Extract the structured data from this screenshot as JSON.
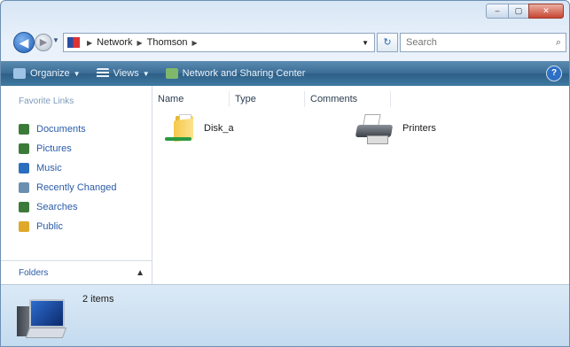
{
  "window": {
    "caption_buttons": {
      "minimize": "–",
      "maximize": "▢",
      "close": "✕"
    }
  },
  "address_bar": {
    "segments": [
      "Network",
      "Thomson"
    ],
    "search_placeholder": "Search"
  },
  "toolbar": {
    "organize_label": "Organize",
    "views_label": "Views",
    "network_center_label": "Network and Sharing Center",
    "help_label": "?"
  },
  "navigation_pane": {
    "heading": "Favorite Links",
    "links": [
      {
        "label": "Documents",
        "icon": "documents-icon",
        "color": "#3c7a3a"
      },
      {
        "label": "Pictures",
        "icon": "pictures-icon",
        "color": "#3c7a3a"
      },
      {
        "label": "Music",
        "icon": "music-icon",
        "color": "#2a6fbf"
      },
      {
        "label": "Recently Changed",
        "icon": "recent-icon",
        "color": "#6b8fb0"
      },
      {
        "label": "Searches",
        "icon": "searches-icon",
        "color": "#3c7a3a"
      },
      {
        "label": "Public",
        "icon": "public-icon",
        "color": "#e0a72a"
      }
    ],
    "folders_label": "Folders"
  },
  "columns": {
    "name": "Name",
    "type": "Type",
    "comments": "Comments"
  },
  "items": [
    {
      "label": "Disk_a",
      "icon": "shared-folder-icon"
    },
    {
      "label": "Printers",
      "icon": "printers-icon"
    }
  ],
  "details_pane": {
    "count": "2 items"
  },
  "colors": {
    "toolbar": "#3a6d96",
    "link": "#2a5ba8",
    "details_bg": "#c4dbef"
  }
}
